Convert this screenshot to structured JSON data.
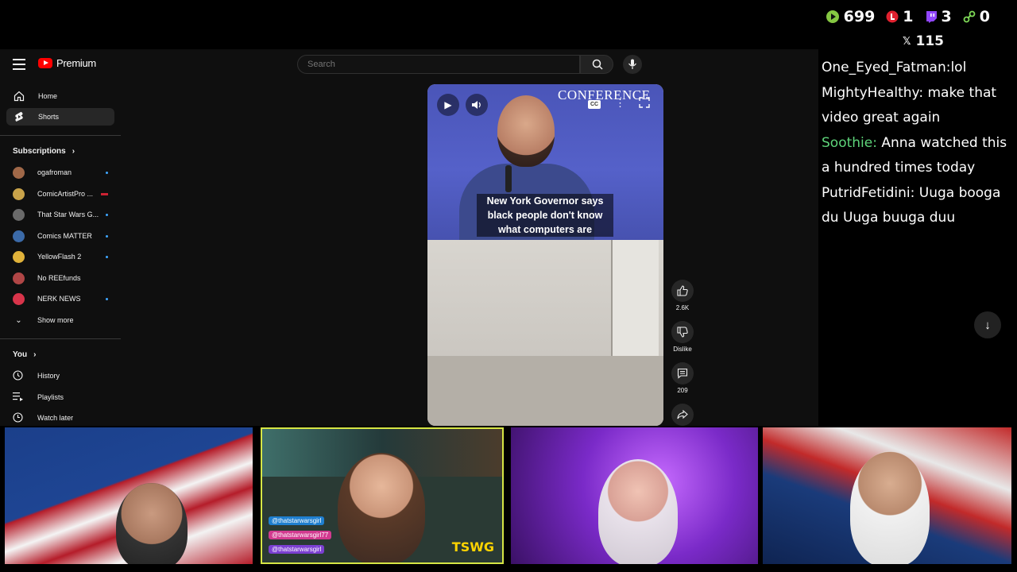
{
  "stream_stats": {
    "rumble": "699",
    "youtube": "1",
    "twitch": "3",
    "links": "0",
    "x": "115"
  },
  "youtube": {
    "brand": "Premium",
    "search": {
      "placeholder": "Search"
    },
    "sidebar": {
      "nav": [
        {
          "label": "Home",
          "icon": "home-icon"
        },
        {
          "label": "Shorts",
          "icon": "shorts-icon"
        }
      ],
      "subscriptions_title": "Subscriptions",
      "subscriptions": [
        {
          "label": "ogafroman",
          "color": "#a06848"
        },
        {
          "label": "ComicArtistPro ...",
          "color": "#c9a34a"
        },
        {
          "label": "That Star Wars G...",
          "color": "#6a6a6a"
        },
        {
          "label": "Comics MATTER",
          "color": "#3b6aa8"
        },
        {
          "label": "YellowFlash 2",
          "color": "#e0b23a"
        },
        {
          "label": "No REEfunds",
          "color": "#b04646"
        },
        {
          "label": "NERK NEWS",
          "color": "#d8344a"
        }
      ],
      "show_more": "Show more",
      "you_title": "You",
      "you_items": [
        {
          "label": "History",
          "icon": "history-icon"
        },
        {
          "label": "Playlists",
          "icon": "playlists-icon"
        },
        {
          "label": "Watch later",
          "icon": "watch-later-icon"
        }
      ]
    },
    "short": {
      "banner": "CONFERENCE",
      "caption": "New York Governor says black people don't know what computers are",
      "likes": "2.6K",
      "dislike_label": "Dislike",
      "comments": "209"
    }
  },
  "chat": [
    {
      "user": "One_Eyed_Fatman:",
      "msg": "lol",
      "user_color": "#ffffff"
    },
    {
      "user": "MightyHealthy:",
      "msg": "make that video great again",
      "user_color": "#ffffff"
    },
    {
      "user": "Soothie:",
      "msg": "Anna watched this a hundred times today",
      "user_color": "#5ed47a"
    },
    {
      "user": "PutridFetidini:",
      "msg": "Uuga booga du Uuga buuga duu",
      "user_color": "#ffffff"
    }
  ],
  "webcams": {
    "cam2_tags": [
      "@thatstarwarsgirl",
      "@thatstarwarsgirl77",
      "@thatstarwarsgirl"
    ],
    "cam2_logo": "TSWG"
  }
}
